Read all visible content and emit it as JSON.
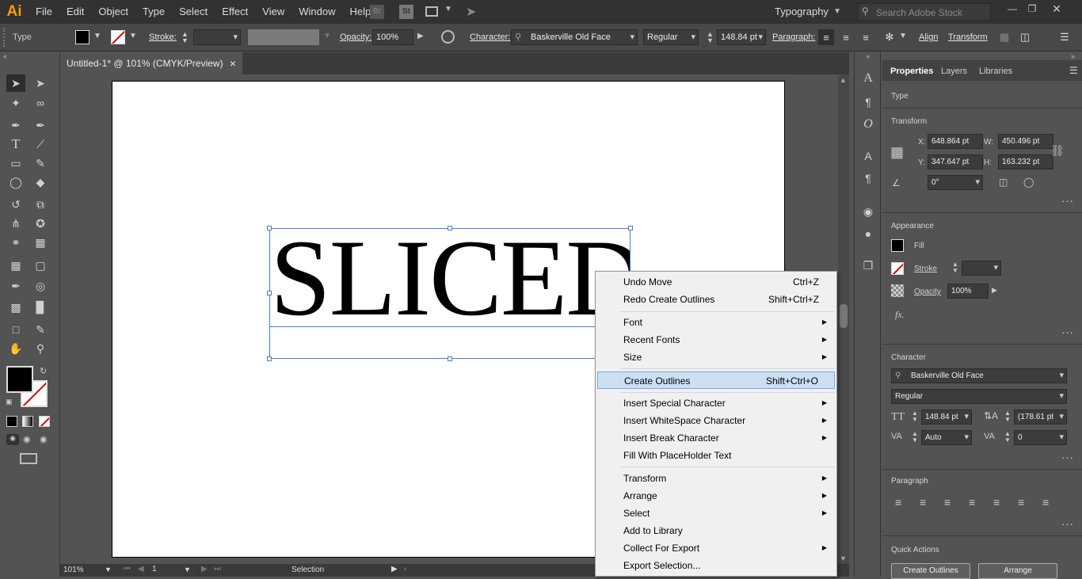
{
  "app": {
    "logo": "Ai"
  },
  "menus": [
    "File",
    "Edit",
    "Object",
    "Type",
    "Select",
    "Effect",
    "View",
    "Window",
    "Help"
  ],
  "menubar_right": {
    "badge_br": "Br",
    "badge_st": "St",
    "workspace": "Typography",
    "search_placeholder": "Search Adobe Stock",
    "window_controls": [
      "minimize",
      "restore",
      "close"
    ]
  },
  "controlbar": {
    "selection_type": "Type",
    "stroke_label": "Stroke:",
    "opacity_label": "Opacity:",
    "opacity_value": "100%",
    "character_label": "Character:",
    "font_family": "Baskerville Old Face",
    "font_style": "Regular",
    "font_size": "148.84 pt",
    "paragraph_label": "Paragraph:",
    "align_label": "Align",
    "transform_label": "Transform"
  },
  "document": {
    "tab_title": "Untitled-1* @ 101% (CMYK/Preview)",
    "close_glyph": "×",
    "artboard_text": "SLICED"
  },
  "statusbar": {
    "zoom": "101%",
    "artboard_number": "1",
    "tool_name": "Selection"
  },
  "context_menu": {
    "items": [
      {
        "label": "Undo Move",
        "shortcut": "Ctrl+Z"
      },
      {
        "label": "Redo Create Outlines",
        "shortcut": "Shift+Ctrl+Z"
      },
      {
        "label": "Font",
        "submenu": true
      },
      {
        "label": "Recent Fonts",
        "submenu": true
      },
      {
        "label": "Size",
        "submenu": true
      },
      {
        "label": "Create Outlines",
        "shortcut": "Shift+Ctrl+O",
        "highlighted": true
      },
      {
        "label": "Insert Special Character",
        "submenu": true
      },
      {
        "label": "Insert WhiteSpace Character",
        "submenu": true
      },
      {
        "label": "Insert Break Character",
        "submenu": true
      },
      {
        "label": "Fill With PlaceHolder Text"
      },
      {
        "label": "Transform",
        "submenu": true
      },
      {
        "label": "Arrange",
        "submenu": true
      },
      {
        "label": "Select",
        "submenu": true
      },
      {
        "label": "Add to Library"
      },
      {
        "label": "Collect For Export",
        "submenu": true
      },
      {
        "label": "Export Selection..."
      }
    ]
  },
  "properties_panel": {
    "tabs": [
      "Properties",
      "Layers",
      "Libraries"
    ],
    "selection_kind": "Type",
    "transform": {
      "title": "Transform",
      "x_label": "X:",
      "x": "648.864 pt",
      "y_label": "Y:",
      "y": "347.647 pt",
      "w_label": "W:",
      "w": "450.496 pt",
      "h_label": "H:",
      "h": "163.232 pt",
      "rotation": "0°"
    },
    "appearance": {
      "title": "Appearance",
      "fill_label": "Fill",
      "stroke_label": "Stroke",
      "opacity_label": "Opacity",
      "opacity_value": "100%",
      "fx": "fx."
    },
    "character": {
      "title": "Character",
      "font_family": "Baskerville Old Face",
      "font_style": "Regular",
      "size": "148.84 pt",
      "leading": "(178.61 pt",
      "kerning": "Auto",
      "tracking": "0"
    },
    "paragraph": {
      "title": "Paragraph"
    },
    "quick_actions": {
      "title": "Quick Actions",
      "create_outlines": "Create Outlines",
      "arrange": "Arrange"
    }
  },
  "colors": {
    "accent": "#4a7fd4",
    "logo": "#ff9a00",
    "menu_highlight": "#cce0f4"
  }
}
